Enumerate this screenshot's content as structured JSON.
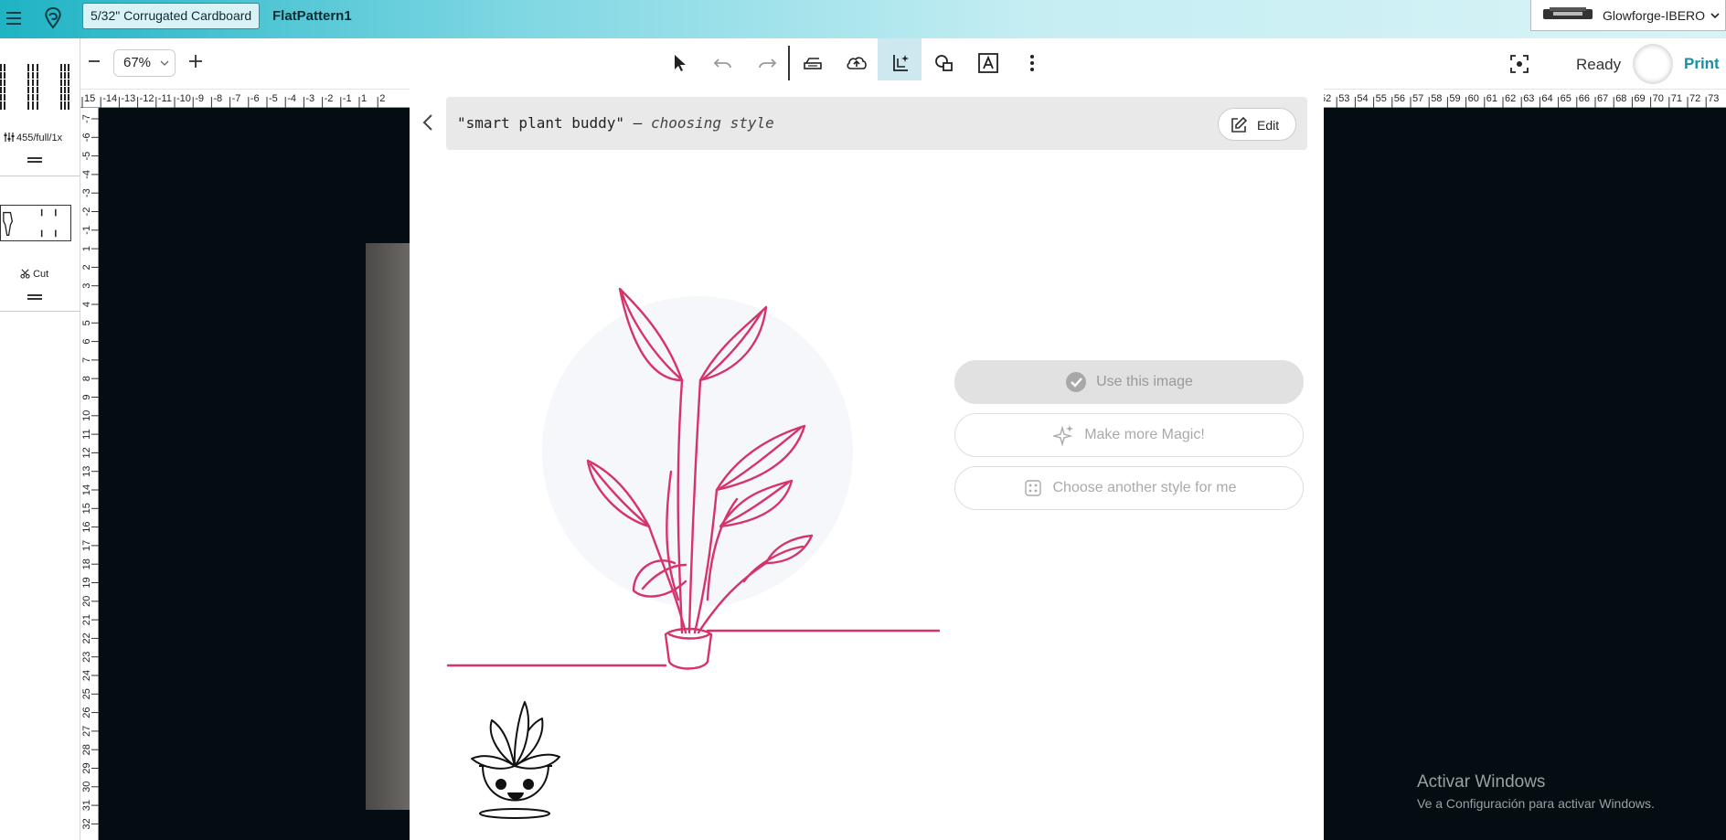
{
  "topbar": {
    "material": "5/32\" Corrugated Cardboard",
    "doc_title": "FlatPattern1",
    "machine": "Glowforge-IBERO"
  },
  "toolbar": {
    "zoom": "67%",
    "status": "Ready",
    "print_label": "Print"
  },
  "left_panel": {
    "settings": "455/full/1x",
    "operation": "Cut"
  },
  "modal": {
    "prompt": "\"smart plant buddy\"",
    "separator": " – ",
    "status": "choosing style",
    "edit_label": "Edit",
    "actions": {
      "use_image": "Use this image",
      "more_magic": "Make more Magic!",
      "another_style": "Choose another style for me"
    },
    "accent_color": "#d6336c"
  },
  "rulers": {
    "top_left": [
      "15",
      "-14",
      "-13",
      "-12",
      "-11",
      "-10",
      "-9",
      "-8",
      "-7",
      "-6",
      "-5",
      "-4",
      "-3",
      "-2",
      "-1",
      "1",
      "2"
    ],
    "top_right": [
      "52",
      "53",
      "54",
      "55",
      "56",
      "57",
      "58",
      "59",
      "60",
      "61",
      "62",
      "63",
      "64",
      "65",
      "66",
      "67",
      "68",
      "69",
      "70",
      "71",
      "72",
      "73"
    ],
    "left": [
      "-7",
      "-6",
      "-5",
      "-4",
      "-3",
      "-2",
      "-1",
      "1",
      "2",
      "3",
      "4",
      "5",
      "6",
      "7",
      "8",
      "9",
      "10",
      "11",
      "12",
      "13",
      "14",
      "15",
      "16",
      "17",
      "18",
      "19",
      "20",
      "21",
      "22",
      "23",
      "24",
      "25",
      "26",
      "27",
      "28",
      "29",
      "30",
      "31",
      "32"
    ]
  },
  "watermark": {
    "title": "Activar Windows",
    "subtitle": "Ve a Configuración para activar Windows."
  }
}
